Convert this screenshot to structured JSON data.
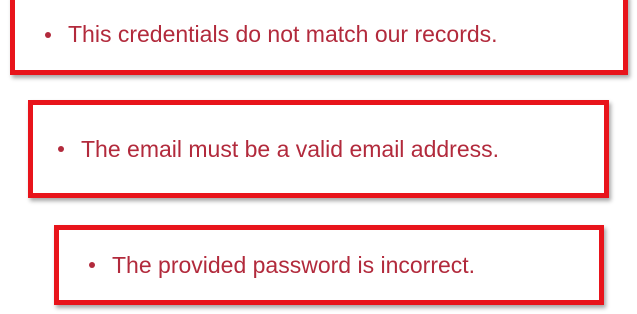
{
  "colors": {
    "border": "#e8141b",
    "error_text": "#b22a3c"
  },
  "errors": [
    {
      "text": "This credentials do not match our records."
    },
    {
      "text": "The email must be a valid email address."
    },
    {
      "text": "The provided password is incorrect."
    }
  ]
}
